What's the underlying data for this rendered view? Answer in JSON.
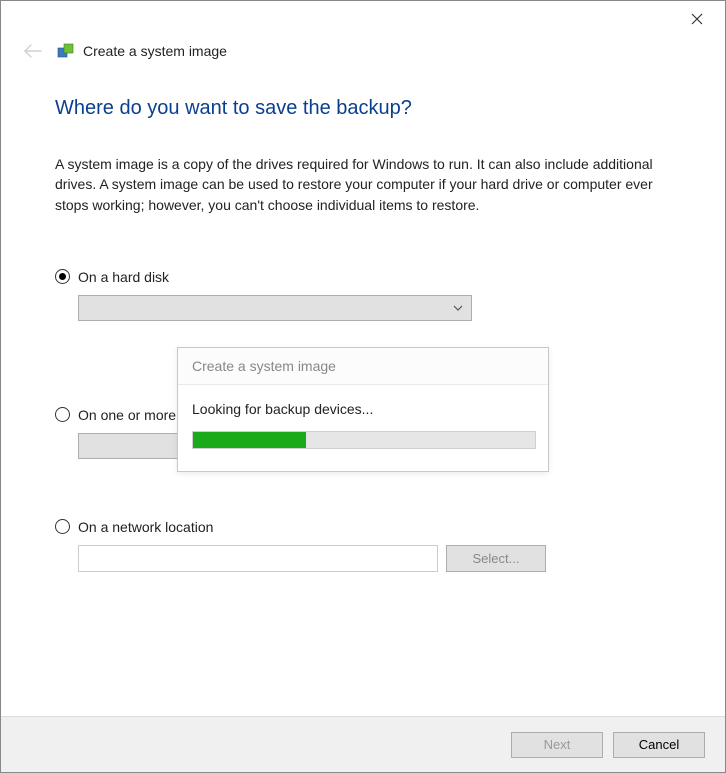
{
  "window": {
    "title": "Create a system image"
  },
  "heading": "Where do you want to save the backup?",
  "description": "A system image is a copy of the drives required for Windows to run. It can also include additional drives. A system image can be used to restore your computer if your hard drive or computer ever stops working; however, you can't choose individual items to restore.",
  "options": {
    "hard_disk": {
      "label": "On a hard disk",
      "selected": true
    },
    "dvd": {
      "label": "On one or more",
      "selected": false
    },
    "network": {
      "label": "On a network location",
      "selected": false,
      "select_button": "Select..."
    }
  },
  "overlay": {
    "title": "Create a system image",
    "status": "Looking for backup devices...",
    "progress_percent": 33
  },
  "footer": {
    "next": "Next",
    "cancel": "Cancel"
  }
}
